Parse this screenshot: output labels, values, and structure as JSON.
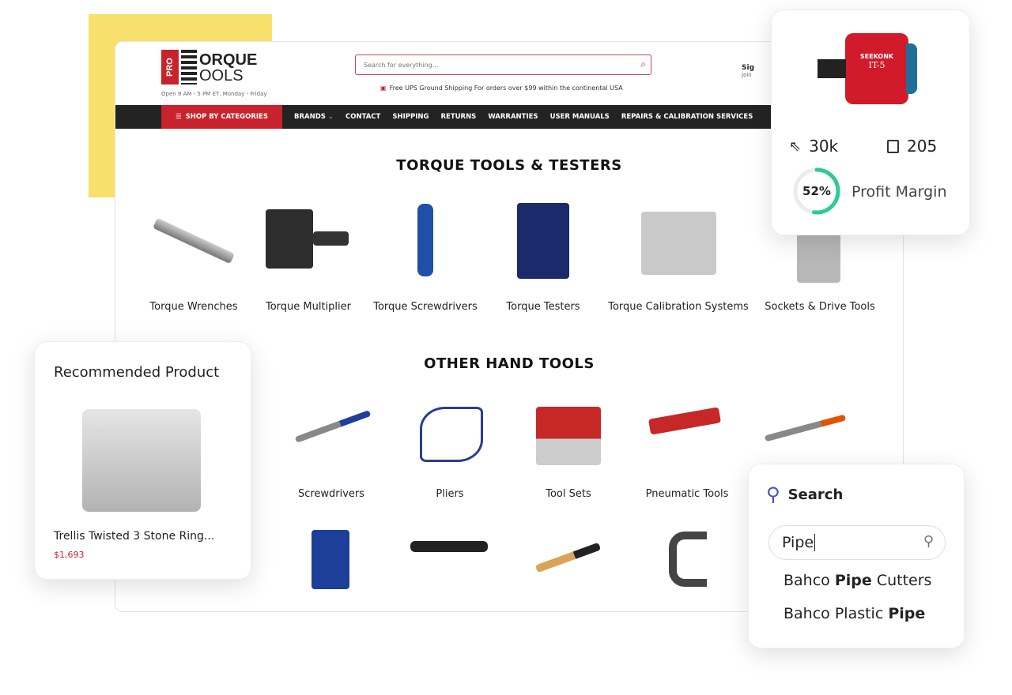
{
  "header": {
    "logo_pro": "PRO",
    "logo_line1": "ORQUE",
    "logo_line2": "OOLS",
    "hours": "Open 9 AM - 5 PM ET, Monday - Friday",
    "search_placeholder": "Search for everything...",
    "shipping": "Free UPS Ground Shipping For orders over $99 within the continental USA",
    "sign_in": "Sig",
    "join": "Join"
  },
  "nav": {
    "shop": "SHOP BY CATEGORIES",
    "items": [
      "BRANDS",
      "CONTACT",
      "SHIPPING",
      "RETURNS",
      "WARRANTIES",
      "USER MANUALS",
      "REPAIRS & CALIBRATION SERVICES"
    ]
  },
  "torque": {
    "title": "TORQUE TOOLS & TESTERS",
    "items": [
      "Torque Wrenches",
      "Torque Multiplier",
      "Torque Screwdrivers",
      "Torque Testers",
      "Torque Calibration Systems",
      "Sockets & Drive Tools"
    ]
  },
  "other": {
    "title": "OTHER HAND TOOLS",
    "items": [
      "Screwdrivers",
      "Pliers",
      "Tool Sets",
      "Pneumatic Tools"
    ]
  },
  "recommended": {
    "title": "Recommended Product",
    "name": "Trellis Twisted 3 Stone Ring...",
    "price": "$1,693"
  },
  "stats": {
    "product_brand": "SEEKONK",
    "product_model": "IT-5",
    "clicks": "30k",
    "orders": "205",
    "profit_margin_pct": 52,
    "profit_margin_text": "52%",
    "profit_label": "Profit Margin",
    "ring_color": "#2ecc8f"
  },
  "search_widget": {
    "title": "Search",
    "query": "Pipe",
    "suggestions": [
      {
        "pre": "Bahco ",
        "bold": "Pipe",
        "post": " Cutters"
      },
      {
        "pre": "Bahco Plastic ",
        "bold": "Pipe",
        "post": ""
      }
    ]
  },
  "colors": {
    "brand_red": "#c8232c",
    "accent_yellow": "#f7e06b"
  }
}
